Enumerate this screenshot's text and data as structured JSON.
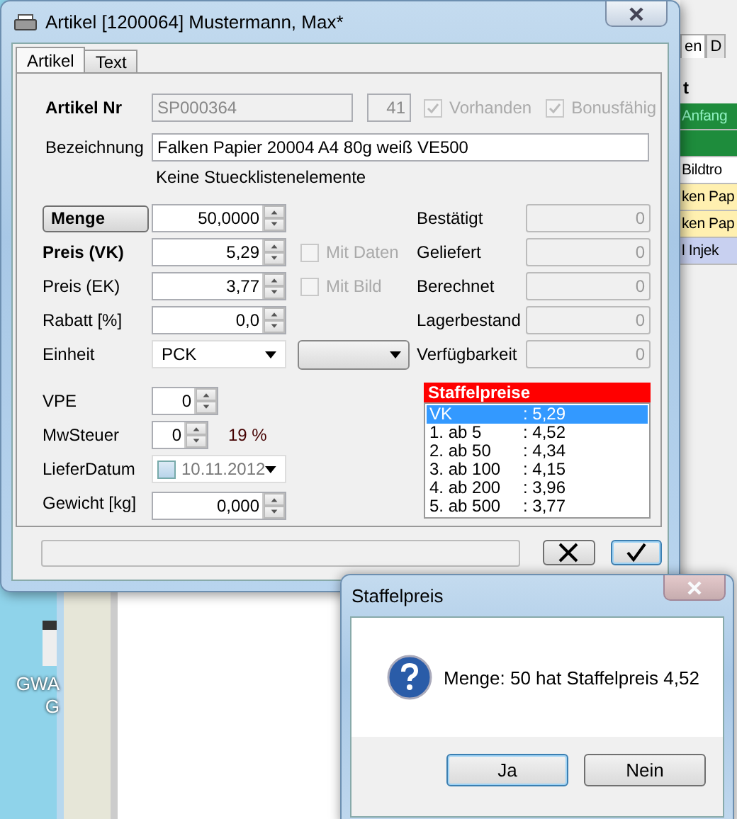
{
  "desktop": {
    "icon_label_lines": [
      "GWA",
      "G"
    ]
  },
  "background_app": {
    "tabs": [
      {
        "label": "en",
        "selected": true
      },
      {
        "label": "D",
        "selected": false
      }
    ],
    "column_header": "t",
    "rows": [
      {
        "text": "Anfang",
        "color": "#1e8c3c"
      },
      {
        "color": "#1e8c3c"
      },
      {
        "text": "Bildtro",
        "color": "#ffffff"
      },
      {
        "text": "ken Pap",
        "color": "#fff0b0"
      },
      {
        "text": "ken Pap",
        "color": "#fff0b0"
      },
      {
        "text": "l Injek",
        "color": "#c8d0f0"
      }
    ]
  },
  "main_window": {
    "title": "Artikel [1200064] Mustermann, Max*",
    "tabs": [
      {
        "label": "Artikel",
        "selected": true
      },
      {
        "label": "Text",
        "selected": false
      }
    ],
    "artikel_nr": {
      "label": "Artikel Nr",
      "value": "SP000364",
      "count": "41"
    },
    "flags": [
      {
        "label": "Vorhanden",
        "checked": true,
        "disabled": true
      },
      {
        "label": "Bonusfähig",
        "checked": true,
        "disabled": true
      }
    ],
    "bezeichnung": {
      "label": "Bezeichnung",
      "value": "Falken Papier 20004 A4 80g weiß VE500"
    },
    "stueckliste_note": "Keine Stuecklistenelemente",
    "price_fields": [
      {
        "label": "Menge",
        "kind": "button",
        "value": "50,0000"
      },
      {
        "label": "Preis (VK)",
        "kind": "bold",
        "value": "5,29"
      },
      {
        "label": "Preis (EK)",
        "kind": "plain",
        "value": "3,77"
      },
      {
        "label": "Rabatt [%]",
        "kind": "plain",
        "value": "0,0"
      }
    ],
    "options": [
      {
        "label": "Mit Daten",
        "checked": false,
        "disabled": true
      },
      {
        "label": "Mit Bild",
        "checked": false,
        "disabled": true
      }
    ],
    "einheit": {
      "label": "Einheit",
      "value": "PCK"
    },
    "vpe": {
      "label": "VPE",
      "value": "0"
    },
    "mwsteuer": {
      "label": "MwSteuer",
      "value": "0",
      "rate": "19 %"
    },
    "lieferdatum": {
      "label": "LieferDatum",
      "value": "10.11.2012",
      "checked": false
    },
    "gewicht": {
      "label": "Gewicht [kg]",
      "value": "0,000"
    },
    "status_fields": [
      {
        "label": "Bestätigt",
        "value": "0"
      },
      {
        "label": "Geliefert",
        "value": "0"
      },
      {
        "label": "Berechnet",
        "value": "0"
      },
      {
        "label": "Lagerbestand",
        "value": "0"
      },
      {
        "label": "Verfügbarkeit",
        "value": "0"
      }
    ],
    "staffelpreise": {
      "title": "Staffelpreise",
      "items": [
        {
          "label": "VK",
          "value": ": 5,29",
          "selected": true
        },
        {
          "label": "1. ab 5",
          "value": ": 4,52",
          "selected": false
        },
        {
          "label": "2. ab 50",
          "value": ": 4,34",
          "selected": false
        },
        {
          "label": "3. ab 100",
          "value": ": 4,15",
          "selected": false
        },
        {
          "label": "4. ab 200",
          "value": ": 3,96",
          "selected": false
        },
        {
          "label": "5. ab 500",
          "value": ": 3,77",
          "selected": false
        }
      ]
    }
  },
  "dialog": {
    "title": "Staffelpreis",
    "message": "Menge: 50 hat Staffelpreis 4,52",
    "buttons": [
      {
        "label": "Ja",
        "focused": true
      },
      {
        "label": "Nein",
        "focused": false
      }
    ]
  }
}
